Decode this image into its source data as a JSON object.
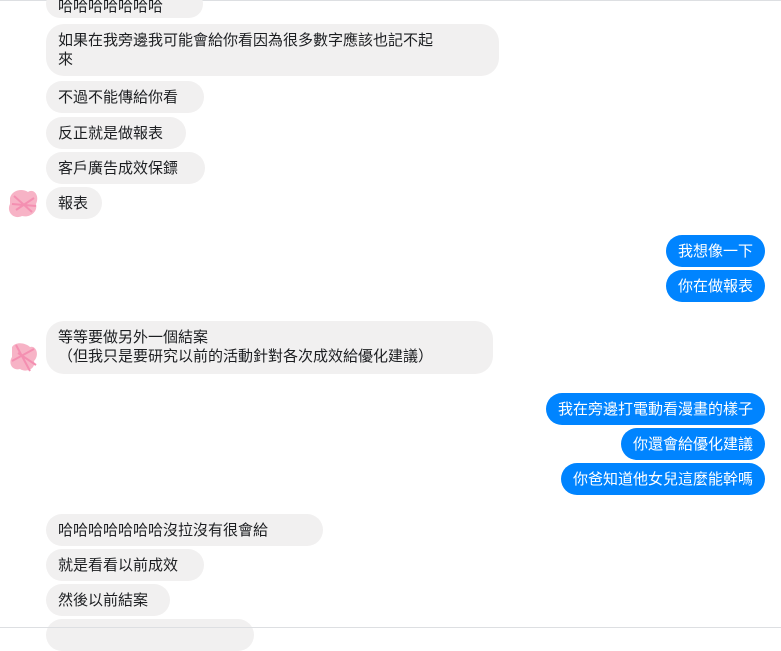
{
  "messages": [
    {
      "side": "in",
      "text": "哈哈哈哈哈哈哈"
    },
    {
      "side": "in",
      "text": "如果在我旁邊我可能會給你看因為很多數字應該也記不起\n來"
    },
    {
      "side": "in",
      "text": "不過不能傳給你看"
    },
    {
      "side": "in",
      "text": "反正就是做報表"
    },
    {
      "side": "in",
      "text": "客戶廣告成效保鏢"
    },
    {
      "side": "in",
      "text": "報表"
    },
    {
      "side": "out",
      "text": "我想像一下"
    },
    {
      "side": "out",
      "text": "你在做報表"
    },
    {
      "side": "in",
      "text": "等等要做另外一個結案\n（但我只是要研究以前的活動針對各次成效給優化建議）"
    },
    {
      "side": "out",
      "text": "我在旁邊打電動看漫畫的樣子"
    },
    {
      "side": "out",
      "text": "你還會給優化建議"
    },
    {
      "side": "out",
      "text": "你爸知道他女兒這麼能幹嗎"
    },
    {
      "side": "in",
      "text": "哈哈哈哈哈哈哈沒拉沒有很會給"
    },
    {
      "side": "in",
      "text": "就是看看以前成效"
    },
    {
      "side": "in",
      "text": "然後以前結案"
    },
    {
      "side": "in",
      "text": ""
    }
  ],
  "colors": {
    "incoming_bubble": "#f1f0f0",
    "outgoing_bubble": "#0084ff",
    "avatar_blur": "#f7b3c6"
  },
  "icons": {
    "avatar": "redacted-avatar-icon"
  }
}
